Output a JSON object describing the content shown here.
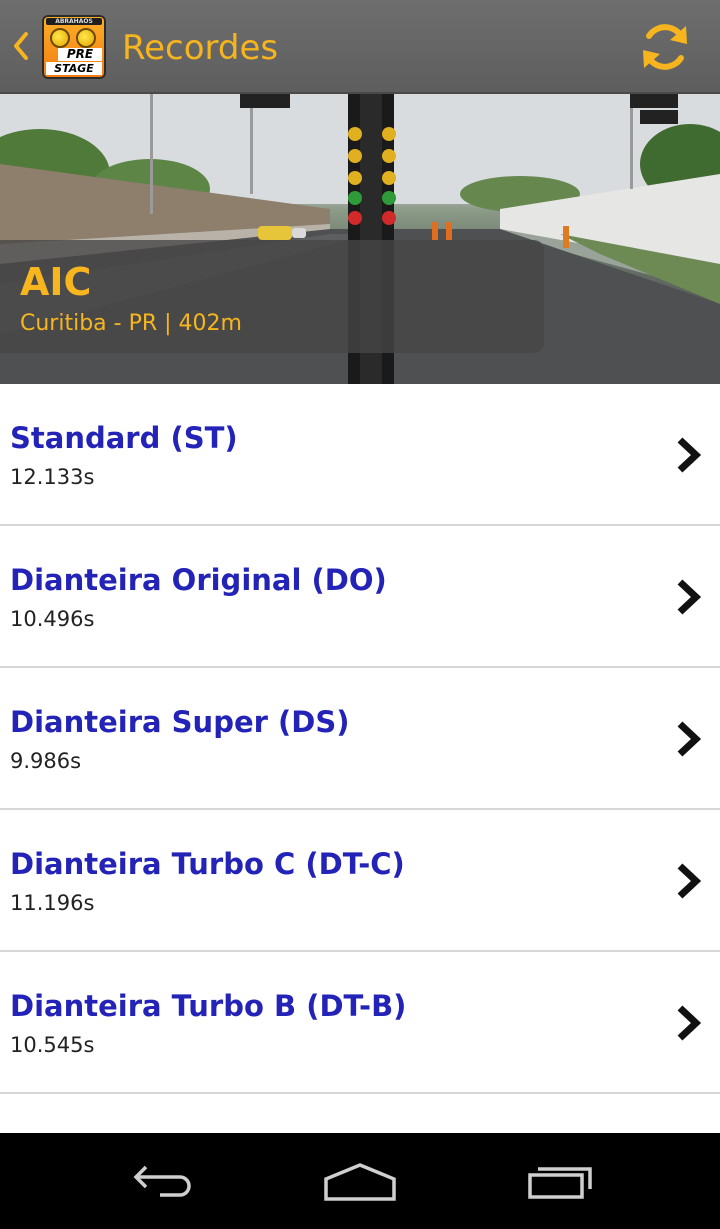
{
  "header": {
    "title": "Recordes",
    "icons": {
      "back": "back-chevron-icon",
      "app": "prestage-app-icon",
      "refresh": "refresh-icon"
    },
    "app_icon_text": {
      "strip": "ABRAHAOS",
      "line1": "PRE",
      "line2": "STAGE"
    },
    "accent_color": "#f6b51e"
  },
  "track": {
    "name": "AIC",
    "location": "Curitiba - PR | 402m"
  },
  "records": [
    {
      "category": "Standard (ST)",
      "time": "12.133s"
    },
    {
      "category": "Dianteira Original (DO)",
      "time": "10.496s"
    },
    {
      "category": "Dianteira Super (DS)",
      "time": "9.986s"
    },
    {
      "category": "Dianteira Turbo C (DT-C)",
      "time": "11.196s"
    },
    {
      "category": "Dianteira Turbo B (DT-B)",
      "time": "10.545s"
    }
  ],
  "colors": {
    "category_text": "#2323b8",
    "time_text": "#222222",
    "divider": "#d6d6d6"
  },
  "navbar": {
    "icons": [
      "back-icon",
      "home-icon",
      "recent-apps-icon"
    ]
  }
}
